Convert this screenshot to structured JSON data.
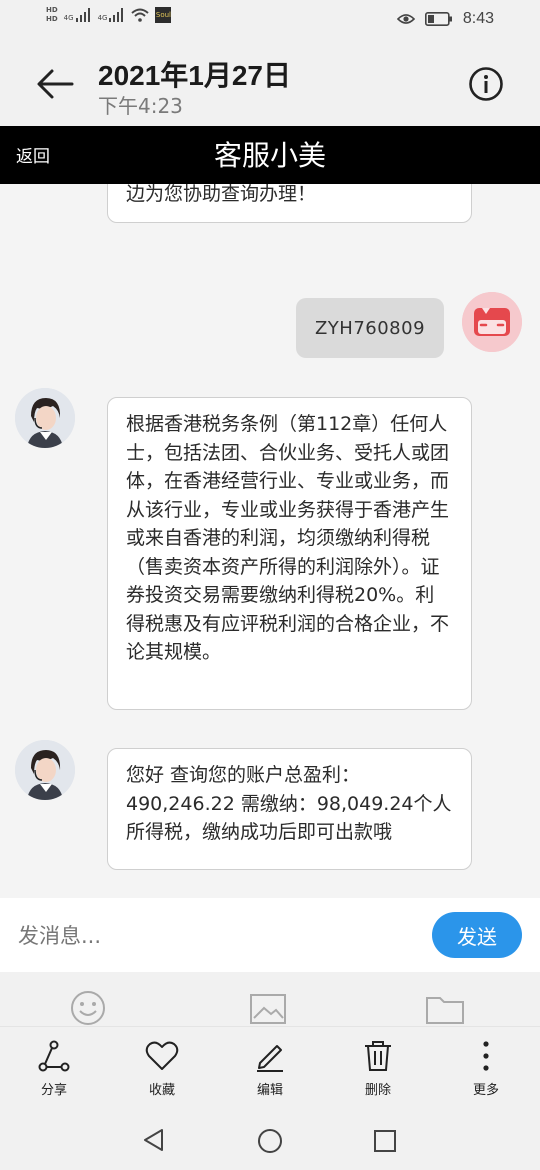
{
  "status_bar": {
    "hd1": "HD",
    "hd2": "HD",
    "net1": "4G",
    "net2": "4G",
    "app_badge": "Soul",
    "time": "8:43"
  },
  "header": {
    "title": "2021年1月27日",
    "subtitle": "下午4:23"
  },
  "chat_bar": {
    "back_label": "返回",
    "title": "客服小美"
  },
  "messages": {
    "partial_text": "边为您协助查询办理！",
    "user_text": "ZYH760809",
    "agent_msg_1": "根据香港税务条例（第112章）任何人士，包括法团、合伙业务、受托人或团体，在香港经营行业、专业或业务，而从该行业，专业或业务获得于香港产生或来自香港的利润，均须缴纳利得税（售卖资本资产所得的利润除外）。证券投资交易需要缴纳利得税20%。利得税惠及有应评税利润的合格企业，不论其规模。",
    "agent_msg_2": "您好 查询您的账户总盈利：490,246.22 需缴纳：98,049.24个人所得税，缴纳成功后即可出款哦"
  },
  "input": {
    "placeholder": "发消息...",
    "send_label": "发送"
  },
  "actions": {
    "share": "分享",
    "favorite": "收藏",
    "edit": "编辑",
    "delete": "删除",
    "more": "更多"
  }
}
